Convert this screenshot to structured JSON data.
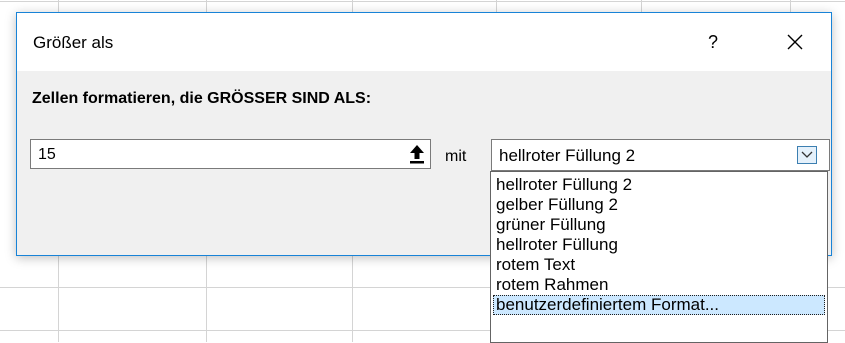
{
  "dialog": {
    "title": "Größer als",
    "help_label": "?",
    "instruction": "Zellen formatieren, die GRÖSSER SIND ALS:",
    "value": "15",
    "with_label": "mit",
    "selected_format": "hellroter Füllung 2",
    "format_options": [
      "hellroter Füllung 2",
      "gelber Füllung 2",
      "grüner Füllung",
      "hellroter Füllung",
      "rotem Text",
      "rotem Rahmen",
      "benutzerdefiniertem Format..."
    ],
    "highlighted_option_index": 6
  },
  "icons": {
    "close": "close-icon",
    "range_selector": "collapse-dialog-arrow-icon",
    "dropdown": "chevron-down-icon"
  },
  "colors": {
    "dialog_border": "#1883d7",
    "option_highlight": "#cce8ff"
  }
}
